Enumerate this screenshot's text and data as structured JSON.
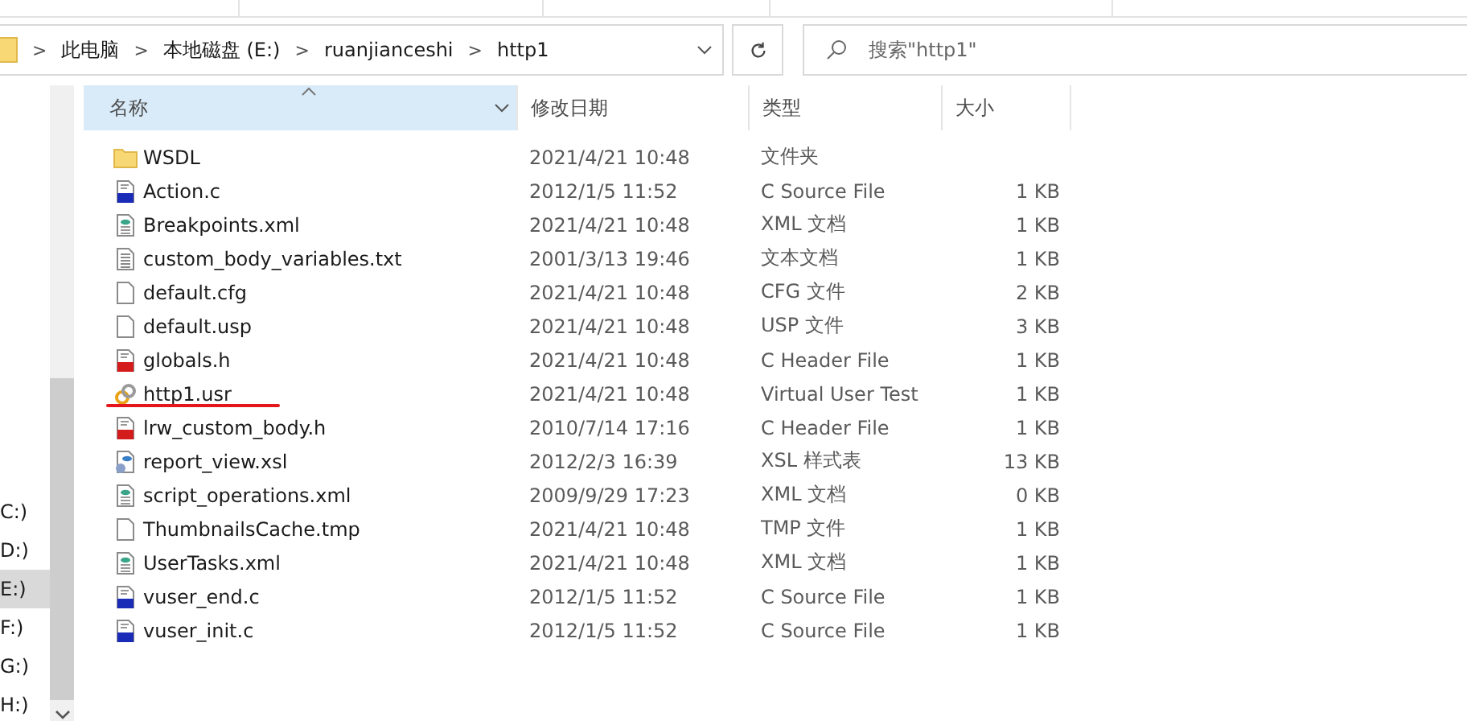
{
  "address_bar": {
    "crumbs": [
      "此电脑",
      "本地磁盘 (E:)",
      "ruanjianceshi",
      "http1"
    ],
    "separator": ">"
  },
  "search": {
    "placeholder": "搜索\"http1\""
  },
  "nav": {
    "items": [
      {
        "label": "C:)",
        "selected": false
      },
      {
        "label": "D:)",
        "selected": false
      },
      {
        "label": "E:)",
        "selected": true
      },
      {
        "label": "F:)",
        "selected": false
      },
      {
        "label": "G:)",
        "selected": false
      },
      {
        "label": "H:)",
        "selected": false
      }
    ]
  },
  "table": {
    "columns": [
      {
        "label": "名称",
        "sorted": true
      },
      {
        "label": "修改日期",
        "sorted": false
      },
      {
        "label": "类型",
        "sorted": false
      },
      {
        "label": "大小",
        "sorted": false
      }
    ],
    "rows": [
      {
        "kind": "folder",
        "name": "WSDL",
        "date": "2021/4/21 10:48",
        "type": "文件夹",
        "underlined": false
      },
      {
        "kind": "c-source",
        "name": "Action.c",
        "date": "2012/1/5 11:52",
        "type": "C Source File",
        "size": "1 KB",
        "underlined": false
      },
      {
        "kind": "xml",
        "name": "Breakpoints.xml",
        "date": "2021/4/21 10:48",
        "type": "XML 文档",
        "size": "1 KB",
        "underlined": false
      },
      {
        "kind": "text",
        "name": "custom_body_variables.txt",
        "date": "2001/3/13 19:46",
        "type": "文本文档",
        "size": "1 KB",
        "underlined": false
      },
      {
        "kind": "blank",
        "name": "default.cfg",
        "date": "2021/4/21 10:48",
        "type": "CFG 文件",
        "size": "2 KB",
        "underlined": false
      },
      {
        "kind": "blank",
        "name": "default.usp",
        "date": "2021/4/21 10:48",
        "type": "USP 文件",
        "size": "3 KB",
        "underlined": false
      },
      {
        "kind": "header",
        "name": "globals.h",
        "date": "2021/4/21 10:48",
        "type": "C Header File",
        "size": "1 KB",
        "underlined": false
      },
      {
        "kind": "usr",
        "name": "http1.usr",
        "date": "2021/4/21 10:48",
        "type": "Virtual User Test",
        "size": "1 KB",
        "underlined": true
      },
      {
        "kind": "header",
        "name": "lrw_custom_body.h",
        "date": "2010/7/14 17:16",
        "type": "C Header File",
        "size": "1 KB",
        "underlined": false
      },
      {
        "kind": "xsl",
        "name": "report_view.xsl",
        "date": "2012/2/3 16:39",
        "type": "XSL 样式表",
        "size": "13 KB",
        "underlined": false
      },
      {
        "kind": "xml",
        "name": "script_operations.xml",
        "date": "2009/9/29 17:23",
        "type": "XML 文档",
        "size": "0 KB",
        "underlined": false
      },
      {
        "kind": "blank",
        "name": "ThumbnailsCache.tmp",
        "date": "2021/4/21 10:48",
        "type": "TMP 文件",
        "size": "1 KB",
        "underlined": false
      },
      {
        "kind": "xml",
        "name": "UserTasks.xml",
        "date": "2021/4/21 10:48",
        "type": "XML 文档",
        "size": "1 KB",
        "underlined": false
      },
      {
        "kind": "c-source",
        "name": "vuser_end.c",
        "date": "2012/1/5 11:52",
        "type": "C Source File",
        "size": "1 KB",
        "underlined": false
      },
      {
        "kind": "c-source",
        "name": "vuser_init.c",
        "date": "2012/1/5 11:52",
        "type": "C Source File",
        "size": "1 KB",
        "underlined": false
      }
    ]
  }
}
